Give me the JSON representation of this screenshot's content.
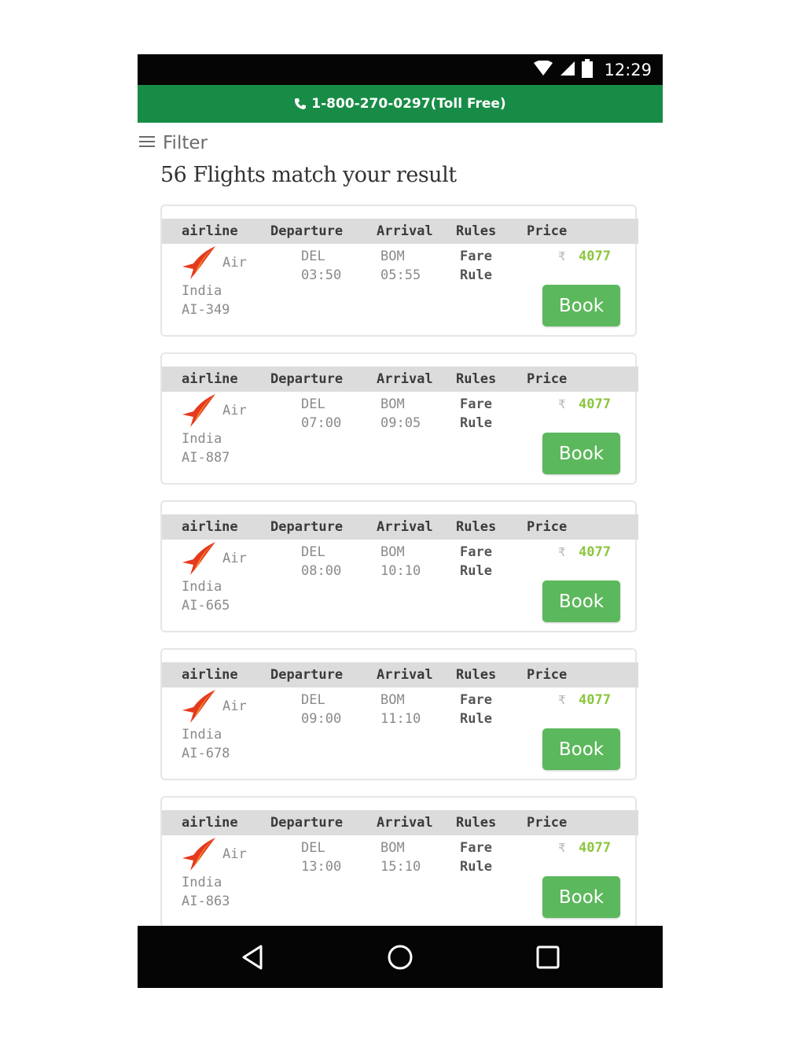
{
  "status_bar": {
    "time": "12:29",
    "icons": [
      "wifi-icon",
      "cellular-signal-icon",
      "battery-icon"
    ]
  },
  "contact_bar": {
    "icon": "phone-icon",
    "text": "1-800-270-0297(Toll Free)",
    "background": "#188c46"
  },
  "filter": {
    "icon": "hamburger-menu-icon",
    "label": "Filter"
  },
  "results_heading": "56 Flights match your result",
  "table_headers": {
    "airline": "airline",
    "departure": "Departure",
    "arrival": "Arrival",
    "rules": "Rules",
    "price": "Price"
  },
  "flights": [
    {
      "airline_line1": "Air",
      "airline_line2": "India",
      "flight_no": "AI-349",
      "dep_code": "DEL",
      "dep_time": "03:50",
      "arr_code": "BOM",
      "arr_time": "05:55",
      "rule_line1": "Fare",
      "rule_line2": "Rule",
      "currency": "₹",
      "price": "4077",
      "book_label": "Book"
    },
    {
      "airline_line1": "Air",
      "airline_line2": "India",
      "flight_no": "AI-887",
      "dep_code": "DEL",
      "dep_time": "07:00",
      "arr_code": "BOM",
      "arr_time": "09:05",
      "rule_line1": "Fare",
      "rule_line2": "Rule",
      "currency": "₹",
      "price": "4077",
      "book_label": "Book"
    },
    {
      "airline_line1": "Air",
      "airline_line2": "India",
      "flight_no": "AI-665",
      "dep_code": "DEL",
      "dep_time": "08:00",
      "arr_code": "BOM",
      "arr_time": "10:10",
      "rule_line1": "Fare",
      "rule_line2": "Rule",
      "currency": "₹",
      "price": "4077",
      "book_label": "Book"
    },
    {
      "airline_line1": "Air",
      "airline_line2": "India",
      "flight_no": "AI-678",
      "dep_code": "DEL",
      "dep_time": "09:00",
      "arr_code": "BOM",
      "arr_time": "11:10",
      "rule_line1": "Fare",
      "rule_line2": "Rule",
      "currency": "₹",
      "price": "4077",
      "book_label": "Book"
    },
    {
      "airline_line1": "Air",
      "airline_line2": "India",
      "flight_no": "AI-863",
      "dep_code": "DEL",
      "dep_time": "13:00",
      "arr_code": "BOM",
      "arr_time": "15:10",
      "rule_line1": "Fare",
      "rule_line2": "Rule",
      "currency": "₹",
      "price": "4077",
      "book_label": "Book"
    }
  ],
  "nav": {
    "back_icon": "back-triangle-icon",
    "home_icon": "home-circle-icon",
    "recents_icon": "recents-square-icon"
  },
  "colors": {
    "price": "#8cc63f",
    "book_button": "#5cb85c",
    "header_row": "#dcdcdc"
  }
}
